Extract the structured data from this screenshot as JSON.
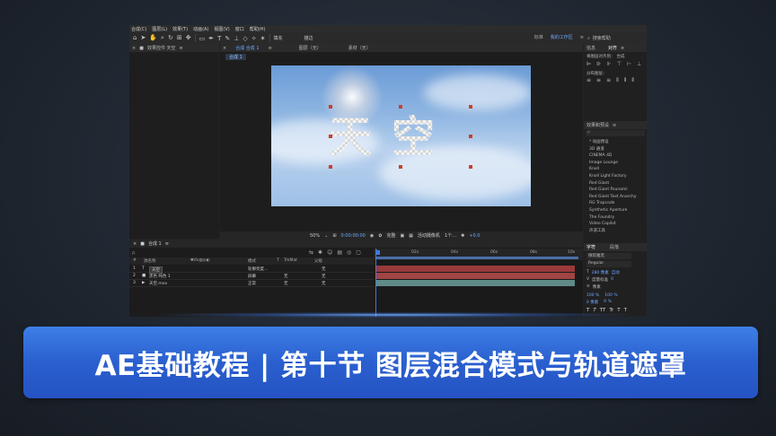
{
  "menu": [
    "合成(C)",
    "图层(L)",
    "效果(T)",
    "动画(A)",
    "视图(V)",
    "窗口",
    "帮助(H)"
  ],
  "toolbar": {
    "fill_label": "填充",
    "stroke_label": "描边",
    "workspaces": [
      "标准",
      "我的工作区"
    ],
    "active_workspace": "我的工作区",
    "search_help": "搜索帮助"
  },
  "fx_panel": {
    "title": "效果控件 天空"
  },
  "comp_panel": {
    "tab": "合成 合成 1",
    "layer_tab": "图层（无）",
    "footage_tab": "素材（无）",
    "breadcrumb": "合成 1",
    "big_text": "天空",
    "footer": {
      "zoom": "50%",
      "timecode": "0:00:00:00",
      "resolution": "完整",
      "camera": "活动摄像机",
      "views": "1个…",
      "exposure": "+0.0"
    }
  },
  "right_panel": {
    "align_tab": "对齐",
    "info_tab": "信息",
    "align_to_label": "将图层对齐到：",
    "align_to_value": "合成",
    "distribute_label": "分布图层：",
    "effects_tab": "效果和预设",
    "effects_search_placeholder": "ρ",
    "effects": [
      "* 动画预设",
      "3D 通道",
      "CINEMA 4D",
      "Image Lounge",
      "Knoll",
      "Knoll Light Factory",
      "Red Giant",
      "Red Giant Psunami",
      "Red Giant Text Anarchy",
      "RG Trapcode",
      "Synthetic Aperture",
      "The Foundry",
      "Video Copilot",
      "声道工具"
    ],
    "char_tab": "字符",
    "para_tab": "段落",
    "font_family": "微软雅黑",
    "font_style": "Regular",
    "font_size": "280 像素",
    "leading": "自动",
    "tracking": "0",
    "kerning": "度量标准",
    "stroke_width": "像素",
    "vert_scale": "100 %",
    "horiz_scale": "100 %",
    "baseline": "0 像素",
    "tsume": "0 %",
    "style_buttons": [
      "T",
      "T",
      "TT",
      "Tr",
      "T",
      "T"
    ]
  },
  "timeline": {
    "tab": "合成 1",
    "search_placeholder": "ρ.",
    "columns": {
      "num": "#",
      "source": "源名称",
      "mode": "模式",
      "t": "T",
      "trkmat": "TrkMat",
      "parent": "父级"
    },
    "layers": [
      {
        "num": "1",
        "type": "T",
        "name": "天空",
        "mode": "轮廓亮度…",
        "trkmat": "",
        "parent": "无",
        "color": "#9a3a3a"
      },
      {
        "num": "2",
        "type": "■",
        "name": "黑色 纯色 1",
        "mode": "屏幕",
        "trkmat": "无",
        "parent": "无",
        "color": "#a04444"
      },
      {
        "num": "3",
        "type": "▶",
        "name": "天空.mov",
        "mode": "正常",
        "trkmat": "无",
        "parent": "无",
        "color": "#5f8a86"
      }
    ],
    "ruler": [
      "0s",
      "02s",
      "04s",
      "06s",
      "08s",
      "10s"
    ]
  },
  "banner": {
    "title": "AE基础教程 | 第十节 图层混合模式与轨道遮罩"
  }
}
